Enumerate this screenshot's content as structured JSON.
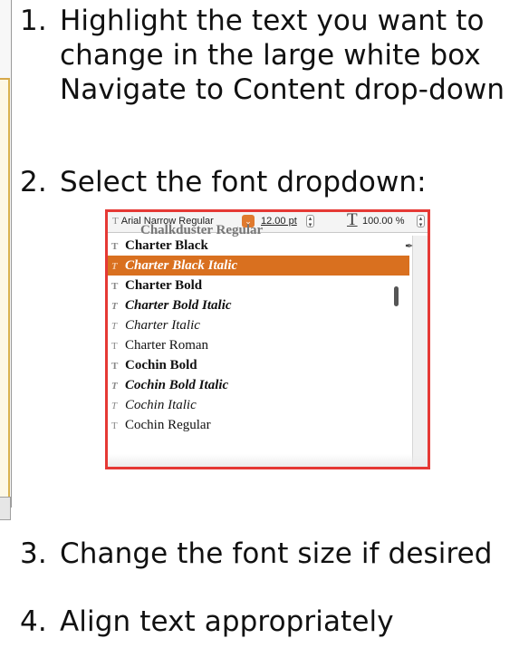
{
  "steps": [
    {
      "number": "1.",
      "lines": [
        "Highlight the text you want to",
        "change in the large white box",
        "Navigate to Content drop-down"
      ]
    },
    {
      "number": "2.",
      "lines": [
        "Select the font dropdown:"
      ]
    },
    {
      "number": "3.",
      "lines": [
        "Change the font size if desired"
      ]
    },
    {
      "number": "4.",
      "lines": [
        "Align text appropriately"
      ]
    }
  ],
  "toolbar": {
    "font_name": "Arial Narrow Regular",
    "font_size": "12.00 pt",
    "scale": "100.00 %",
    "dropdown_arrow": "⌄",
    "big_t": "T"
  },
  "ghost_text": "Chalkduster Regular",
  "font_list": [
    {
      "label": "Charter Black",
      "weight": "bold",
      "selected": false
    },
    {
      "label": "Charter Black Italic",
      "weight": "bolditalic",
      "selected": true
    },
    {
      "label": "Charter Bold",
      "weight": "bold",
      "selected": false
    },
    {
      "label": "Charter Bold Italic",
      "weight": "bolditalic",
      "selected": false
    },
    {
      "label": "Charter Italic",
      "weight": "italic",
      "selected": false
    },
    {
      "label": "Charter Roman",
      "weight": "regular",
      "selected": false
    },
    {
      "label": "Cochin Bold",
      "weight": "bold",
      "selected": false
    },
    {
      "label": "Cochin Bold Italic",
      "weight": "bolditalic",
      "selected": false
    },
    {
      "label": "Cochin Italic",
      "weight": "italic",
      "selected": false
    },
    {
      "label": "Cochin Regular",
      "weight": "regular",
      "selected": false
    }
  ],
  "colors": {
    "highlight_border": "#e53935",
    "selection": "#d9701f",
    "frame_accent": "#d6a84a"
  },
  "icons": {
    "font_item": "font-type-icon",
    "eyedropper": "eyedropper-icon"
  }
}
